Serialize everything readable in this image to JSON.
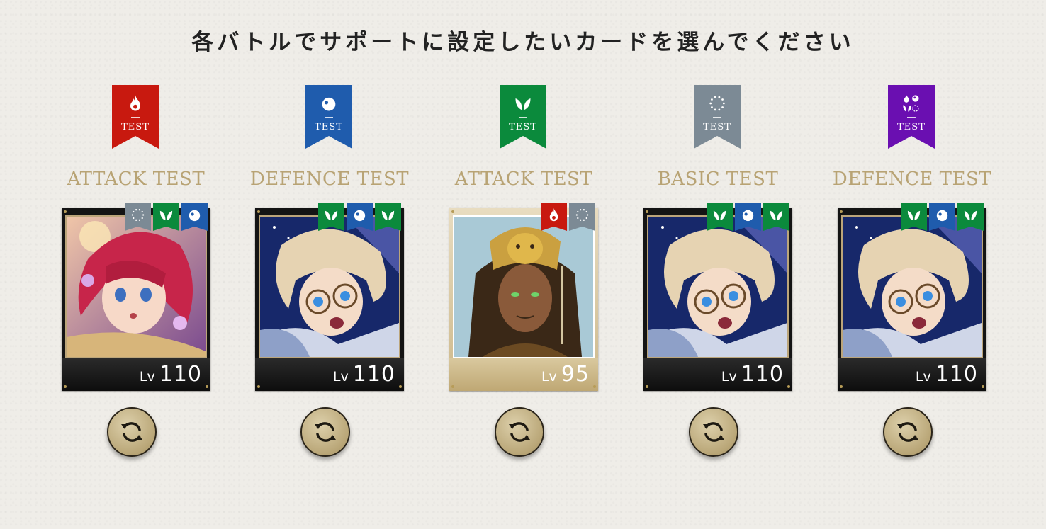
{
  "header": {
    "title": "各バトルでサポートに設定したいカードを選んでください"
  },
  "colors": {
    "attribute": {
      "fire": "#c8190f",
      "water": "#1f5cad",
      "wind": "#0b8a3c",
      "none": "#7c8a95",
      "multi": "#6a0fb1"
    },
    "battle_name": "#b8a374"
  },
  "battles": [
    {
      "ribbon_attr": "fire",
      "ribbon_text": "TEST",
      "name": "ATTACK TEST",
      "card": {
        "frame": "dark",
        "level_label": "Lv",
        "level": "110",
        "tags": [
          "none",
          "wind",
          "water"
        ],
        "portrait": "red-haired-girl"
      },
      "swap_icon": "refresh-icon"
    },
    {
      "ribbon_attr": "water",
      "ribbon_text": "TEST",
      "name": "DEFENCE TEST",
      "card": {
        "frame": "dark",
        "level_label": "Lv",
        "level": "110",
        "tags": [
          "wind",
          "water",
          "wind"
        ],
        "portrait": "glasses-boy"
      },
      "swap_icon": "refresh-icon"
    },
    {
      "ribbon_attr": "wind",
      "ribbon_text": "TEST",
      "name": "ATTACK TEST",
      "card": {
        "frame": "gold",
        "level_label": "Lv",
        "level": "95",
        "tags": [
          "fire",
          "none"
        ],
        "portrait": "lion-mask-man"
      },
      "swap_icon": "refresh-icon"
    },
    {
      "ribbon_attr": "none",
      "ribbon_text": "TEST",
      "name": "BASIC TEST",
      "card": {
        "frame": "dark",
        "level_label": "Lv",
        "level": "110",
        "tags": [
          "wind",
          "water",
          "wind"
        ],
        "portrait": "glasses-boy"
      },
      "swap_icon": "refresh-icon"
    },
    {
      "ribbon_attr": "multi",
      "ribbon_text": "TEST",
      "name": "DEFENCE TEST",
      "card": {
        "frame": "dark",
        "level_label": "Lv",
        "level": "110",
        "tags": [
          "wind",
          "water",
          "wind"
        ],
        "portrait": "glasses-boy"
      },
      "swap_icon": "refresh-icon"
    }
  ]
}
